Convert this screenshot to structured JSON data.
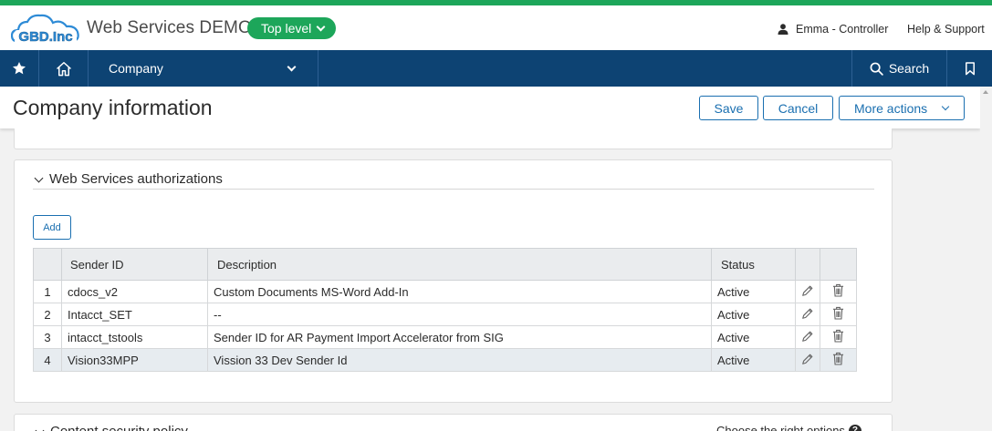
{
  "app": {
    "logo_text": "GBD.Inc",
    "title": "Web Services DEMO",
    "level_label": "Top level",
    "user_label": "Emma - Controller",
    "help_label": "Help & Support"
  },
  "nav": {
    "company_label": "Company",
    "search_label": "Search"
  },
  "page": {
    "title": "Company information",
    "save_label": "Save",
    "cancel_label": "Cancel",
    "more_actions_label": "More actions"
  },
  "section": {
    "title": "Web Services authorizations",
    "add_label": "Add",
    "columns": {
      "sender_id": "Sender ID",
      "description": "Description",
      "status": "Status"
    },
    "rows": [
      {
        "num": "1",
        "sender_id": "cdocs_v2",
        "description": "Custom Documents MS-Word Add-In",
        "status": "Active"
      },
      {
        "num": "2",
        "sender_id": "Intacct_SET",
        "description": "--",
        "status": "Active"
      },
      {
        "num": "3",
        "sender_id": "intacct_tstools",
        "description": "Sender ID for AR Payment Import Accelerator from SIG",
        "status": "Active"
      },
      {
        "num": "4",
        "sender_id": "Vision33MPP",
        "description": "Vission 33 Dev Sender Id",
        "status": "Active"
      }
    ]
  },
  "next_section": {
    "title": "Content security policy",
    "hint": "Choose the right options"
  },
  "colors": {
    "accent_green": "#1da65a",
    "nav_blue": "#0d4373",
    "link_blue": "#1a6fb0"
  },
  "icons": [
    "star-icon",
    "home-icon",
    "chevron-down-icon",
    "search-icon",
    "bookmark-icon",
    "user-icon",
    "pencil-icon",
    "trash-icon",
    "help-circle-icon"
  ]
}
